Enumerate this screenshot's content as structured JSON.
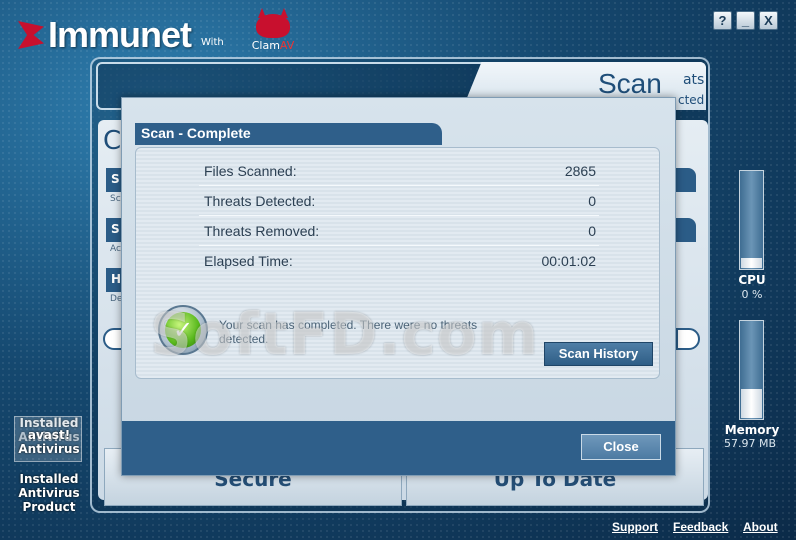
{
  "header": {
    "logo_text": "Immunet",
    "with_text": "With",
    "clamav_text": "Clam",
    "clamav_suffix": "AV",
    "window_buttons": {
      "help": "?",
      "minimize": "_",
      "close": "X"
    }
  },
  "main": {
    "active_tab": "Scan",
    "behind_right_lines": [
      "ats",
      "cted"
    ],
    "behind_left_letter": "C",
    "behind_rows": [
      "S",
      "S",
      "H"
    ],
    "behind_row_subtext": [
      "Sc",
      "Ac",
      "De"
    ],
    "bottom_buttons": [
      "Secure",
      "Up To Date"
    ]
  },
  "sidebar_left": {
    "installed_top": "Installed",
    "installed_top2": "Antivirus",
    "avast_line1": "avast!",
    "avast_line2": "Antivirus",
    "installed_product_lines": [
      "Installed",
      "Antivirus",
      "Product"
    ]
  },
  "sidebar_right": {
    "cpu": {
      "label": "CPU",
      "value": "0 %",
      "fill_fraction": 0.1
    },
    "memory": {
      "label": "Memory",
      "value": "57.97 MB",
      "fill_fraction": 0.3
    }
  },
  "dialog": {
    "title": "Scan - Complete",
    "stats": [
      {
        "label": "Files Scanned:",
        "value": "2865"
      },
      {
        "label": "Threats Detected:",
        "value": "0"
      },
      {
        "label": "Threats Removed:",
        "value": "0"
      },
      {
        "label": "Elapsed Time:",
        "value": "00:01:02"
      }
    ],
    "message": "Your scan has completed. There were no threats detected.",
    "scan_history_label": "Scan History",
    "close_label": "Close"
  },
  "footer": {
    "links": [
      "Support",
      "Feedback",
      "About"
    ]
  },
  "watermark": "SoftFD.com"
}
